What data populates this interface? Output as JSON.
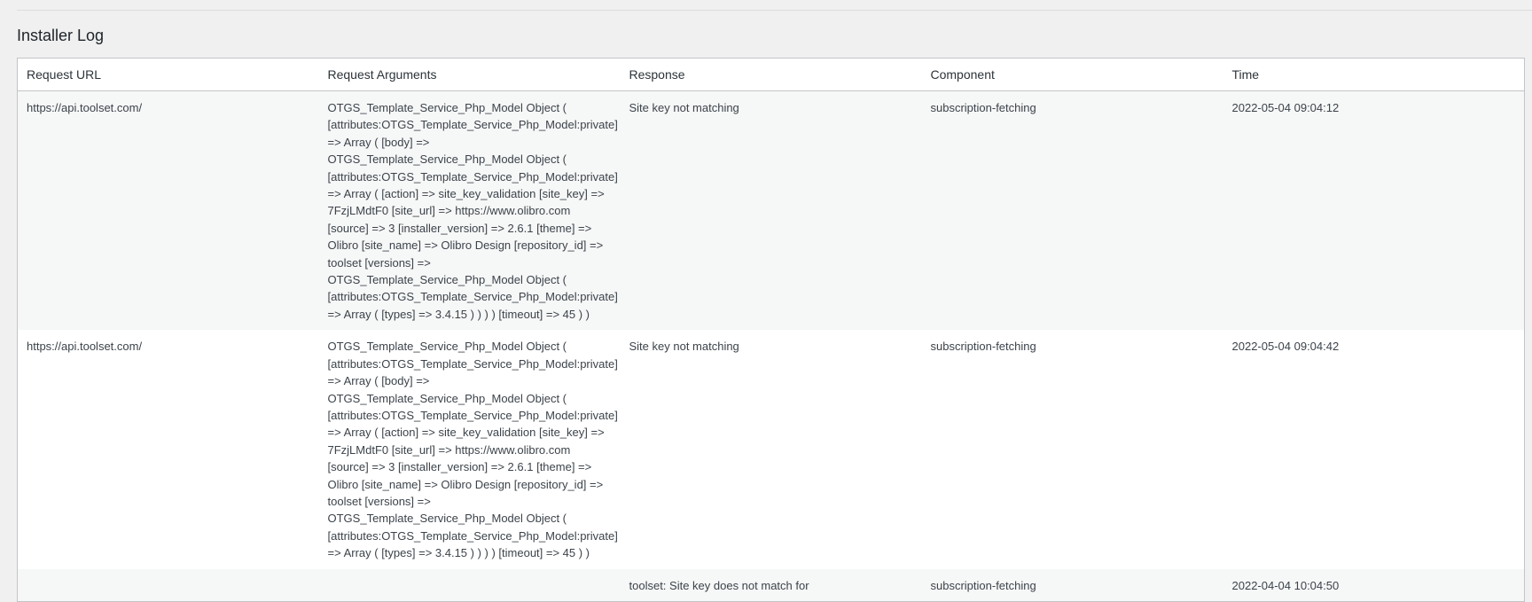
{
  "section": {
    "title": "Installer Log"
  },
  "table": {
    "headers": [
      "Request URL",
      "Request Arguments",
      "Response",
      "Component",
      "Time"
    ],
    "rows": [
      {
        "url": "https://api.toolset.com/",
        "args_lines": [
          "OTGS_Template_Service_Php_Model Object (",
          "[attributes:OTGS_Template_Service_Php_Model:private]",
          "=> Array ( [body] =>",
          "OTGS_Template_Service_Php_Model Object (",
          "[attributes:OTGS_Template_Service_Php_Model:private]",
          "=> Array ( [action] => site_key_validation [site_key] =>",
          "7FzjLMdtF0 [site_url] => https://www.olibro.com",
          "[source] => 3 [installer_version] => 2.6.1 [theme] =>",
          "Olibro [site_name] => Olibro Design [repository_id] =>",
          "toolset [versions] =>",
          "OTGS_Template_Service_Php_Model Object (",
          "[attributes:OTGS_Template_Service_Php_Model:private]",
          "=> Array ( [types] => 3.4.15 ) ) ) ) [timeout] => 45 ) )"
        ],
        "response": "Site key not matching",
        "component": "subscription-fetching",
        "time": "2022-05-04 09:04:12"
      },
      {
        "url": "https://api.toolset.com/",
        "args_lines": [
          "OTGS_Template_Service_Php_Model Object (",
          "[attributes:OTGS_Template_Service_Php_Model:private]",
          "=> Array ( [body] =>",
          "OTGS_Template_Service_Php_Model Object (",
          "[attributes:OTGS_Template_Service_Php_Model:private]",
          "=> Array ( [action] => site_key_validation [site_key] =>",
          "7FzjLMdtF0 [site_url] => https://www.olibro.com",
          "[source] => 3 [installer_version] => 2.6.1 [theme] =>",
          "Olibro [site_name] => Olibro Design [repository_id] =>",
          "toolset [versions] =>",
          "OTGS_Template_Service_Php_Model Object (",
          "[attributes:OTGS_Template_Service_Php_Model:private]",
          "=> Array ( [types] => 3.4.15 ) ) ) ) [timeout] => 45 ) )"
        ],
        "response": "Site key not matching",
        "component": "subscription-fetching",
        "time": "2022-05-04 09:04:42"
      },
      {
        "url": "",
        "args_lines": [],
        "response": "toolset: Site key does not match for",
        "component": "subscription-fetching",
        "time": "2022-04-04 10:04:50"
      }
    ]
  }
}
